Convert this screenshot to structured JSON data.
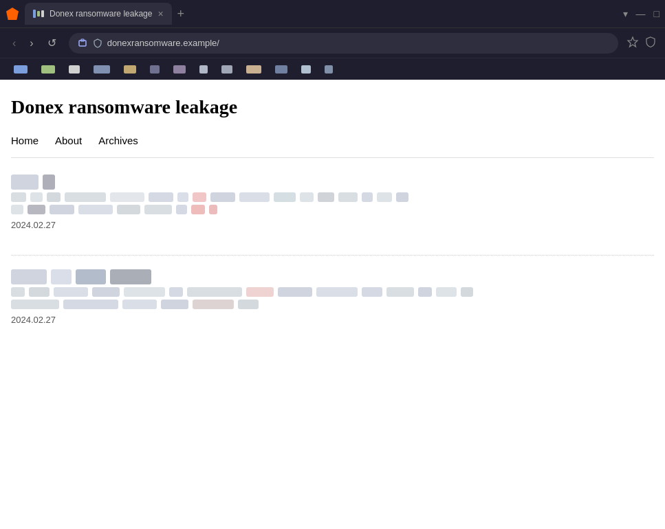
{
  "browser": {
    "tab": {
      "favicon_colors": [
        "#7b9edc",
        "#a0c080",
        "#d0d0d0"
      ],
      "title": "Donex ransomware leakage",
      "close_label": "×"
    },
    "new_tab_label": "+",
    "window_controls": {
      "dropdown": "▾",
      "minimize": "—",
      "maximize": "□"
    },
    "nav": {
      "back_label": "‹",
      "forward_label": "›",
      "refresh_label": "↺",
      "address": "donexransomware.example/",
      "extensions": [
        "🔖",
        "🛡"
      ]
    },
    "bookmarks": []
  },
  "page": {
    "title": "Donex ransomware leakage",
    "nav": {
      "home_label": "Home",
      "about_label": "About",
      "archives_label": "Archives"
    },
    "posts": [
      {
        "date": "2024.02.27"
      },
      {
        "date": "2024.02.27"
      }
    ]
  }
}
